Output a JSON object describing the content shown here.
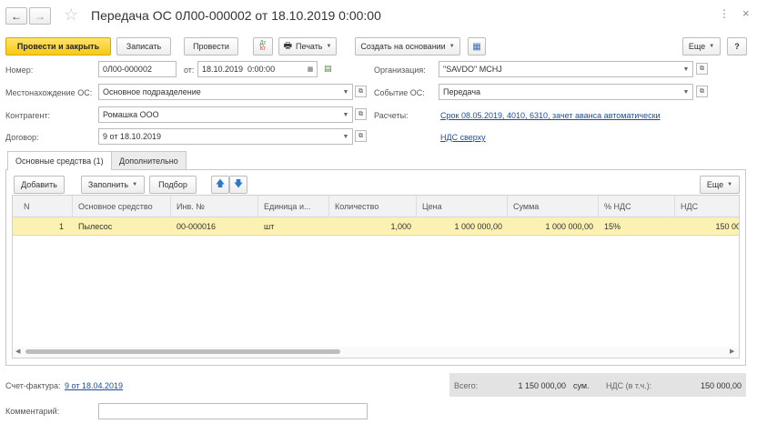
{
  "header": {
    "title": "Передача ОС 0Л00-000002 от 18.10.2019 0:00:00",
    "back_icon": "arrow-left",
    "forward_icon": "arrow-right",
    "favorite_icon": "star",
    "more_icon": "vertical-ellipsis",
    "close_icon": "x"
  },
  "toolbar": {
    "post_close": "Провести и закрыть",
    "save": "Записать",
    "post": "Провести",
    "print": "Печать",
    "create_based": "Создать на основании",
    "more": "Еще",
    "help": "?"
  },
  "form": {
    "number_label": "Номер:",
    "number_value": "0Л00-000002",
    "date_label": "от:",
    "date_value": "18.10.2019  0:00:00",
    "location_label": "Местонахождение ОС:",
    "location_value": "Основное подразделение",
    "contractor_label": "Контрагент:",
    "contractor_value": "Ромашка ООО",
    "contract_label": "Договор:",
    "contract_value": "9 от 18.10.2019",
    "org_label": "Организация:",
    "org_value": "\"SAVDO\" MCHJ",
    "event_label": "Событие ОС:",
    "event_value": "Передача",
    "settlements_label": "Расчеты:",
    "settlements_link": "Срок 08.05.2019, 4010, 6310, зачет аванса автоматически",
    "vat_link": "НДС сверху"
  },
  "tabs": [
    {
      "label": "Основные средства (1)"
    },
    {
      "label": "Дополнительно"
    }
  ],
  "table_toolbar": {
    "add": "Добавить",
    "fill": "Заполнить",
    "select": "Подбор",
    "more": "Еще"
  },
  "table": {
    "columns": [
      "N",
      "Основное средство",
      "Инв. №",
      "Единица и...",
      "Количество",
      "Цена",
      "Сумма",
      "% НДС",
      "НДС"
    ],
    "rows": [
      [
        "1",
        "Пылесос",
        "00-000016",
        "шт",
        "1,000",
        "1 000 000,00",
        "1 000 000,00",
        "15%",
        "150 00"
      ]
    ]
  },
  "footer": {
    "invoice_label": "Счет-фактура:",
    "invoice_link": "9 от 18.04.2019",
    "total_label": "Всего:",
    "total_value": "1 150 000,00",
    "currency": "сум.",
    "vat_incl_label": "НДС (в т.ч.):",
    "vat_incl_value": "150 000,00",
    "comment_label": "Комментарий:",
    "comment_value": ""
  },
  "colors": {
    "primary_button": "#f6c913",
    "selected_row": "#fbf1b3",
    "link": "#1a4fa0",
    "totals_bg": "#e3e3e3"
  }
}
